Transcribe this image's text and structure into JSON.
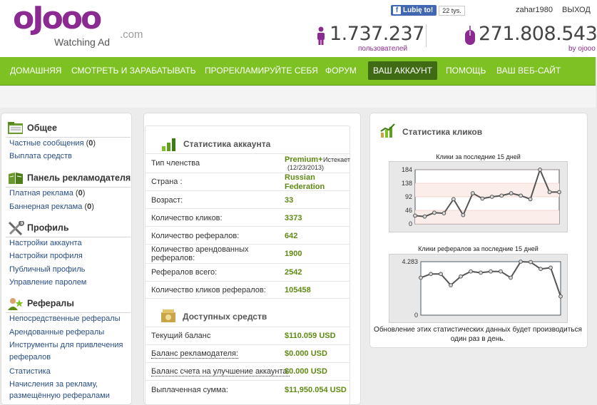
{
  "header": {
    "logo_word": "oJooo",
    "logo_dotcom": ".com",
    "logo_tagline": "Watching Ad",
    "fb_like_label": "Lubię to!",
    "fb_like_count": "22 tys.",
    "username": "zahar1980",
    "logout": "ВЫХОД",
    "users_count": "1.737.237",
    "users_label": "пользователей",
    "clicks_count": "271.808.543",
    "clicks_label": "by ojooo"
  },
  "nav": {
    "home": "ДОМАШНЯЯ",
    "watch_earn": "СМОТРЕТЬ И ЗАРАБАТЫВАТЬ",
    "advertise": "ПРОРЕКЛАМИРУЙТЕ СЕБЯ",
    "forum": "ФОРУМ",
    "account": "ВАШ АККАУНТ",
    "help": "ПОМОЩЬ",
    "website": "ВАШ ВЕБ-САЙТ"
  },
  "sidebar": {
    "general": {
      "title": "Общее",
      "messages_label": "Частные сообщения",
      "messages_open": " (",
      "messages_count": "0",
      "messages_close": ")",
      "payout": "Выплата средств"
    },
    "advertiser": {
      "title": "Панель рекламодателя",
      "paid_label": "Платная реклама",
      "paid_count": "0",
      "banner_label": "Баннерная реклама",
      "banner_count": "0"
    },
    "profile": {
      "title": "Профиль",
      "account_settings": "Настройки аккаунта",
      "profile_settings": "Настройки профиля",
      "public_profile": "Публичный профиль",
      "password": "Управление паролем"
    },
    "referrals": {
      "title": "Рефералы",
      "direct": "Непосредственные рефералы",
      "rented": "Арендованные рефералы",
      "tools_line1": "Инструменты для привлечения",
      "tools_line2": "рефералов",
      "stats": "Статистика",
      "earnings_line1": "Начисления за рекламу,",
      "earnings_line2": "размещённую рефералами"
    }
  },
  "account": {
    "stats_title": "Статистика аккаунта",
    "rows": [
      {
        "label": "Тип членства",
        "value": "Premium+",
        "extra": "Истекает",
        "extra2": "(12/23/2013)"
      },
      {
        "label": "Страна :",
        "value": "Russian",
        "value2": "Federation"
      },
      {
        "label": "Возраст:",
        "value": "33"
      },
      {
        "label": "Количество кликов:",
        "value": "3373"
      },
      {
        "label": "Количество рефералов:",
        "value": "642"
      },
      {
        "label": "Количество арендованных",
        "label2": "рефералов:",
        "value": "1900"
      },
      {
        "label": "Рефералов всего:",
        "value": "2542"
      },
      {
        "label": "Количество кликов рефералов:",
        "value": "105458"
      }
    ],
    "funds_title": "Доступных средств",
    "funds": [
      {
        "label": "Текущий баланс",
        "value": "$110.059 USD"
      },
      {
        "label": "Баланс рекламодателя:",
        "value": "$0.000 USD"
      },
      {
        "label": "Баланс счета на улучшение аккаунта:",
        "value": "$0.000 USD"
      },
      {
        "label": "Выплаченная сумма:",
        "value": "$11,950.054 USD"
      }
    ]
  },
  "click_stats": {
    "title": "Статистика кликов",
    "note": "Обновление этих статистических данных будет производиться один раз в день."
  },
  "colors": {
    "brand_purple": "#8b2b91",
    "nav_green": "#7ec123",
    "nav_active": "#3e6b13",
    "value_green": "#5f8a12",
    "link_blue": "#2a4e86",
    "line_gray": "#555555"
  },
  "chart_data": [
    {
      "type": "line",
      "title": "Клики за последние 15 дней",
      "x": [
        1,
        2,
        3,
        4,
        5,
        6,
        7,
        8,
        9,
        10,
        11,
        12,
        13,
        14,
        15,
        16
      ],
      "series": [
        {
          "values": [
            28,
            25,
            38,
            36,
            84,
            30,
            104,
            86,
            92,
            96,
            104,
            96,
            84,
            184,
            108,
            108
          ]
        }
      ],
      "ylim": [
        0,
        184
      ],
      "yticks": [
        "184",
        "138",
        "92",
        "46",
        "0"
      ],
      "grid": true
    },
    {
      "type": "line",
      "title": "Клики рефералов за последние 15 дней",
      "x": [
        1,
        2,
        3,
        4,
        5,
        6,
        7,
        8,
        9,
        10,
        11,
        12,
        13,
        14,
        15,
        16
      ],
      "series": [
        {
          "values": [
            3.0,
            3.3,
            3.3,
            2.4,
            3.1,
            3.5,
            3.4,
            3.5,
            3.5,
            3.0,
            4.283,
            4.25,
            3.7,
            3.8,
            1.5
          ]
        }
      ],
      "ylim": [
        0,
        4.283
      ],
      "yticks": [
        "4.283",
        "0"
      ],
      "grid": false
    }
  ]
}
